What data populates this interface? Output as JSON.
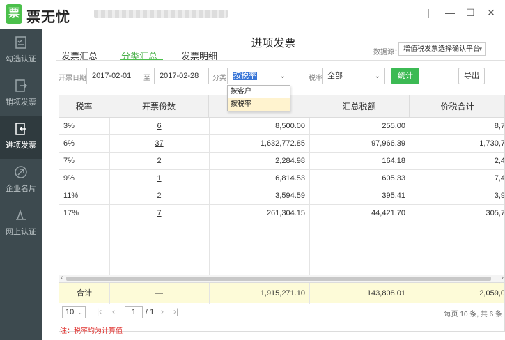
{
  "app": {
    "logo_char": "票",
    "name": "票无忧"
  },
  "window": {
    "minimize": "—",
    "maximize": "☐",
    "close": "✕"
  },
  "sidebar": {
    "items": [
      {
        "label": "勾选认证",
        "icon": "checklist-icon",
        "active": false
      },
      {
        "label": "销项发票",
        "icon": "invoice-out-icon",
        "active": false
      },
      {
        "label": "进项发票",
        "icon": "invoice-in-icon",
        "active": true
      },
      {
        "label": "企业名片",
        "icon": "business-card-icon",
        "active": false
      },
      {
        "label": "网上认证",
        "icon": "online-auth-icon",
        "active": false
      }
    ]
  },
  "page": {
    "title": "进项发票",
    "tabs": [
      {
        "label": "发票汇总",
        "active": false
      },
      {
        "label": "分类汇总",
        "active": true
      },
      {
        "label": "发票明细",
        "active": false
      }
    ],
    "source": {
      "label": "数据源：",
      "value": "增值税发票选择确认平台"
    }
  },
  "filters": {
    "date_label": "开票日期",
    "date_from": "2017-02-01",
    "to_label": "至",
    "date_to": "2017-02-28",
    "category_label": "分类",
    "category_value": "按税率",
    "category_options": [
      "按客户",
      "按税率"
    ],
    "tax_label": "税率",
    "tax_value": "全部",
    "stats_button": "统计",
    "export_button": "导出"
  },
  "table": {
    "headers": [
      "税率",
      "开票份数",
      "",
      "汇总税额",
      "价税合计"
    ],
    "rows": [
      {
        "rate": "3%",
        "count": "6",
        "amount": "8,500.00",
        "tax": "255.00",
        "total": "8,7"
      },
      {
        "rate": "6%",
        "count": "37",
        "amount": "1,632,772.85",
        "tax": "97,966.39",
        "total": "1,730,7"
      },
      {
        "rate": "7%",
        "count": "2",
        "amount": "2,284.98",
        "tax": "164.18",
        "total": "2,4"
      },
      {
        "rate": "9%",
        "count": "1",
        "amount": "6,814.53",
        "tax": "605.33",
        "total": "7,4"
      },
      {
        "rate": "11%",
        "count": "2",
        "amount": "3,594.59",
        "tax": "395.41",
        "total": "3,9"
      },
      {
        "rate": "17%",
        "count": "7",
        "amount": "261,304.15",
        "tax": "44,421.70",
        "total": "305,7"
      }
    ],
    "totals": {
      "label": "合计",
      "count": "—",
      "amount": "1,915,271.10",
      "tax": "143,808.01",
      "total": "2,059,0"
    }
  },
  "pager": {
    "page_size": "10",
    "current_page": "1",
    "total_pages": "/ 1",
    "summary": "每页 10 条, 共 6 条"
  },
  "note": "注：税率均为计算值"
}
